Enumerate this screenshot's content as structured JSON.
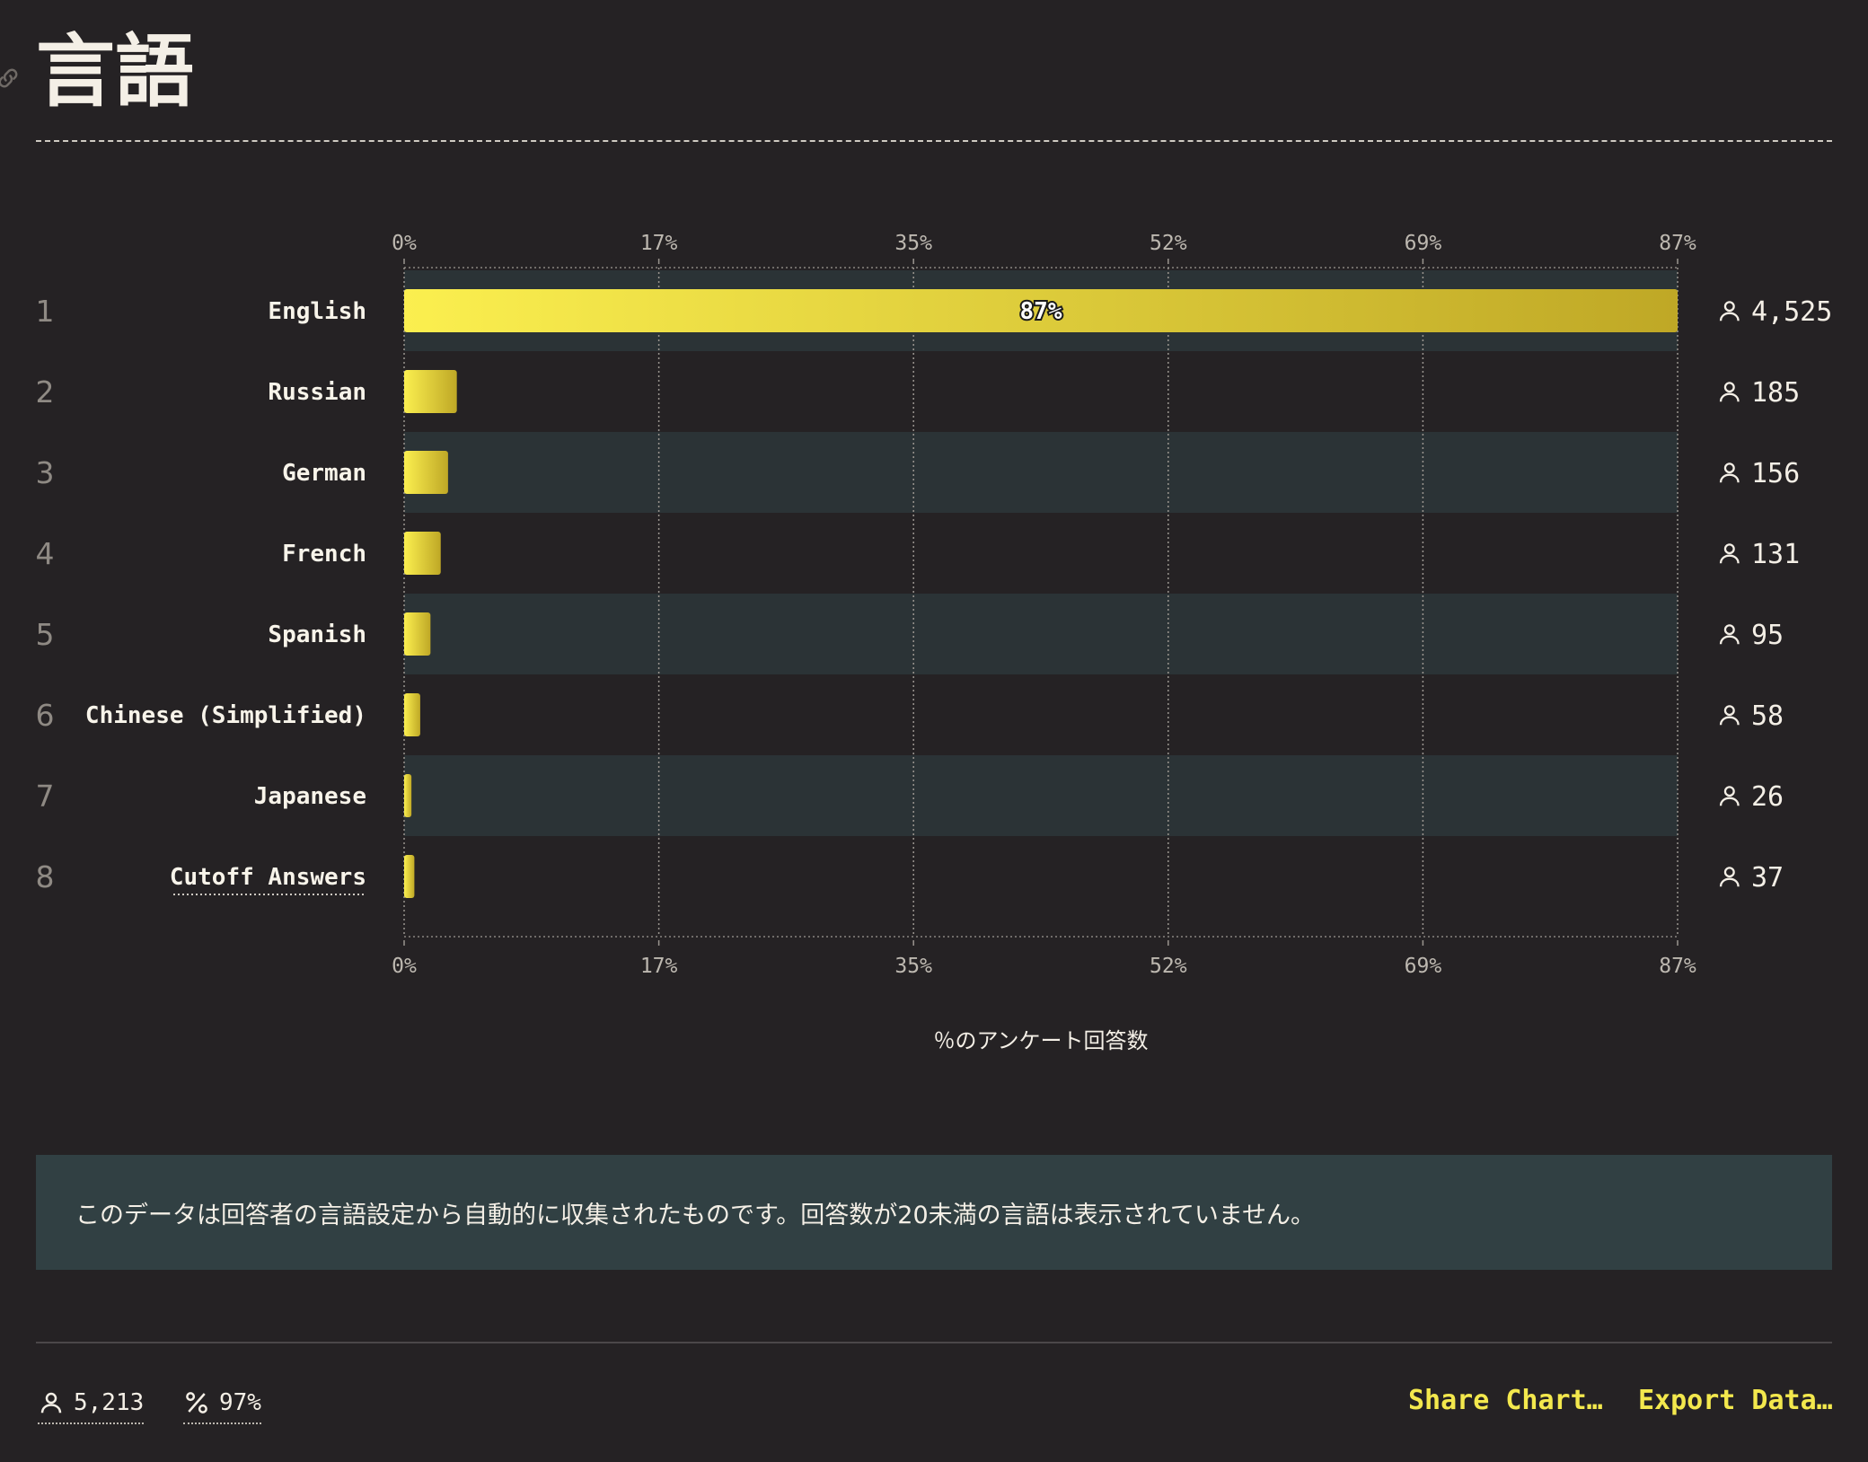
{
  "page": {
    "title": "言語",
    "note": "このデータは回答者の言語設定から自動的に収集されたものです。回答数が20未満の言語は表示されていません。",
    "footer": {
      "respondents": "5,213",
      "percent": "97%",
      "share_label": "Share Chart…",
      "export_label": "Export Data…"
    }
  },
  "colors": {
    "background": "#252224",
    "accent": "#f3e84d",
    "bar_start": "#fbef4f",
    "bar_end": "#bfa826",
    "row_band": "#2b3336",
    "note_bg": "#314043"
  },
  "chart_data": {
    "type": "bar",
    "orientation": "horizontal",
    "xlabel": "％のアンケート回答数",
    "xlim": [
      0,
      87
    ],
    "ticks": [
      "0%",
      "17%",
      "35%",
      "52%",
      "69%",
      "87%"
    ],
    "tick_values": [
      0,
      17.4,
      34.8,
      52.2,
      69.6,
      87
    ],
    "grid": true,
    "categories": [
      "English",
      "Russian",
      "German",
      "French",
      "Spanish",
      "Chinese (Simplified)",
      "Japanese",
      "Cutoff Answers"
    ],
    "ranks": [
      "1",
      "2",
      "3",
      "4",
      "5",
      "6",
      "7",
      "8"
    ],
    "values": [
      87,
      3.6,
      3.0,
      2.5,
      1.8,
      1.1,
      0.5,
      0.7
    ],
    "counts": [
      "4,525",
      "185",
      "156",
      "131",
      "95",
      "58",
      "26",
      "37"
    ],
    "value_labels": [
      "87%",
      "",
      "",
      "",
      "",
      "",
      "",
      ""
    ],
    "count_icon": "person-icon"
  }
}
